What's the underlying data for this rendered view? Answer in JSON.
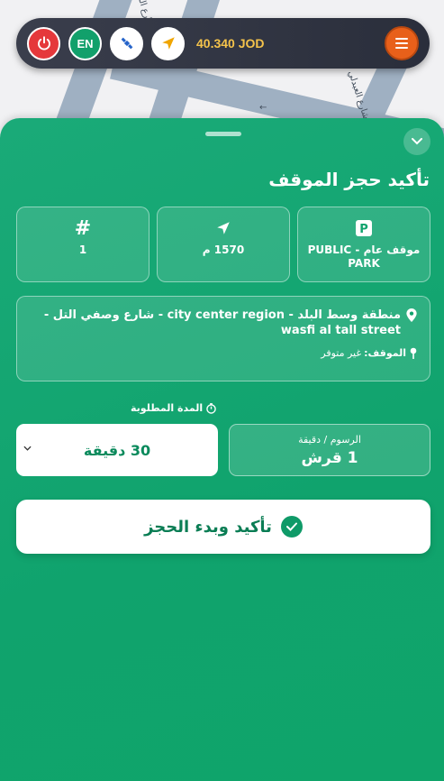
{
  "map": {
    "street_label_1": "شارع الملك",
    "street_label_2": "شارع العبدلي"
  },
  "topbar": {
    "language_label": "EN",
    "balance": "40.340 JOD"
  },
  "sheet": {
    "title": "تأكيد حجز الموقف",
    "cards": {
      "type_value": "موقف عام - PUBLIC PARK",
      "distance_value": "1570 م",
      "number_value": "1"
    },
    "location": {
      "address": "منطقة وسط البلد - city center region - شارع وصفي التل - wasfi al tall street",
      "spot_label": "الموقف:",
      "spot_value": "غير متوفر"
    },
    "duration_label": "المدة المطلوبة",
    "duration_selected": "30 دقيقة",
    "fee_label": "الرسوم / دقيقة",
    "fee_value": "1 قرش",
    "confirm_label": "تأكيد وبدء الحجز"
  },
  "colors": {
    "accent_green": "#10a36d",
    "power_red": "#e5383b",
    "menu_orange": "#e8601a",
    "balance_gold": "#f5c34b"
  },
  "icons": [
    "power-icon",
    "satellite-icon",
    "navigation-arrow-icon",
    "menu-icon",
    "chevron-down-icon",
    "parking-icon",
    "hash-icon",
    "location-pin-icon",
    "timer-icon",
    "check-icon"
  ]
}
